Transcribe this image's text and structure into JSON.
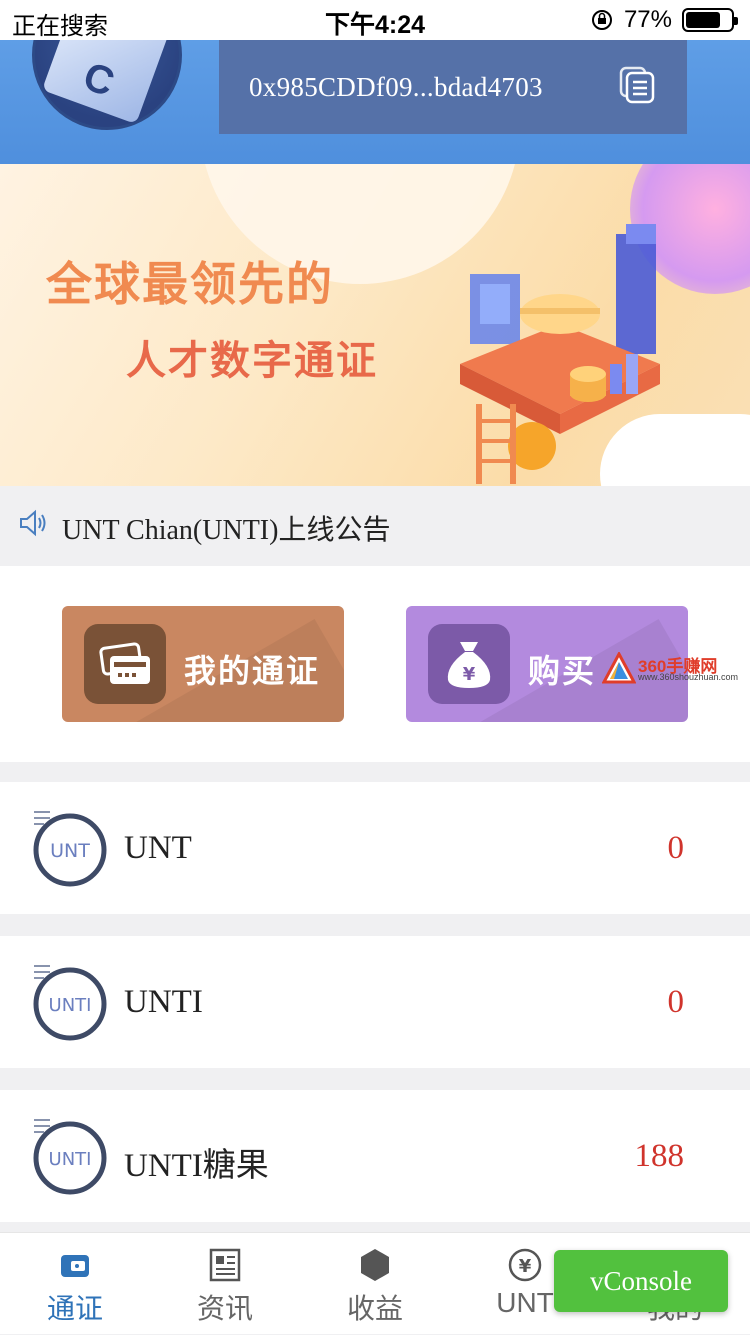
{
  "status_bar": {
    "carrier": "正在搜索",
    "time": "下午4:24",
    "battery": "77%",
    "battery_level": 0.77
  },
  "header": {
    "logo_text": "C",
    "address": "0x985CDDf09...bdad4703",
    "copy_icon": "copy-icon"
  },
  "banner": {
    "line1": "全球最领先的",
    "line2": "人才数字通证"
  },
  "notice": {
    "icon": "speaker-icon",
    "text": "UNT Chian(UNTI)上线公告"
  },
  "actions": [
    {
      "label": "我的通证",
      "icon": "wallet-card-icon",
      "color": "#c98761"
    },
    {
      "label": "购买",
      "icon": "money-bag-icon",
      "color": "#b38ade"
    }
  ],
  "watermark": {
    "text": "360手赚网",
    "sub": "www.360shouzhuan.com"
  },
  "assets": [
    {
      "name": "UNT",
      "badge": "UNT",
      "value": "0"
    },
    {
      "name": "UNTI",
      "badge": "UNTI",
      "value": "0"
    },
    {
      "name": "UNTI糖果",
      "badge": "UNTI",
      "value": "188"
    }
  ],
  "tabbar": {
    "tabs": [
      {
        "label": "通证",
        "icon": "wallet-icon",
        "active": true
      },
      {
        "label": "资讯",
        "icon": "news-icon",
        "active": false
      },
      {
        "label": "收益",
        "icon": "hexagon-icon",
        "active": false
      },
      {
        "label": "UNT",
        "icon": "yen-circle-icon",
        "active": false
      },
      {
        "label": "我的",
        "icon": "user-icon",
        "active": false
      }
    ]
  },
  "vconsole": {
    "label": "vConsole"
  },
  "colors": {
    "accent": "#2f73b8",
    "value_red": "#d0342c",
    "vconsole_green": "#52c13e"
  }
}
